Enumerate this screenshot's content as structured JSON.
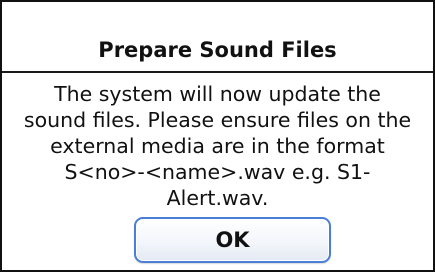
{
  "dialog": {
    "title": "Prepare Sound Files",
    "message_lines": [
      "The system will now update the",
      "sound files. Please ensure files on the",
      "external media are in the format",
      "S<no>-<name>.wav e.g. S1-",
      "Alert.wav."
    ],
    "ok_label": "OK"
  }
}
